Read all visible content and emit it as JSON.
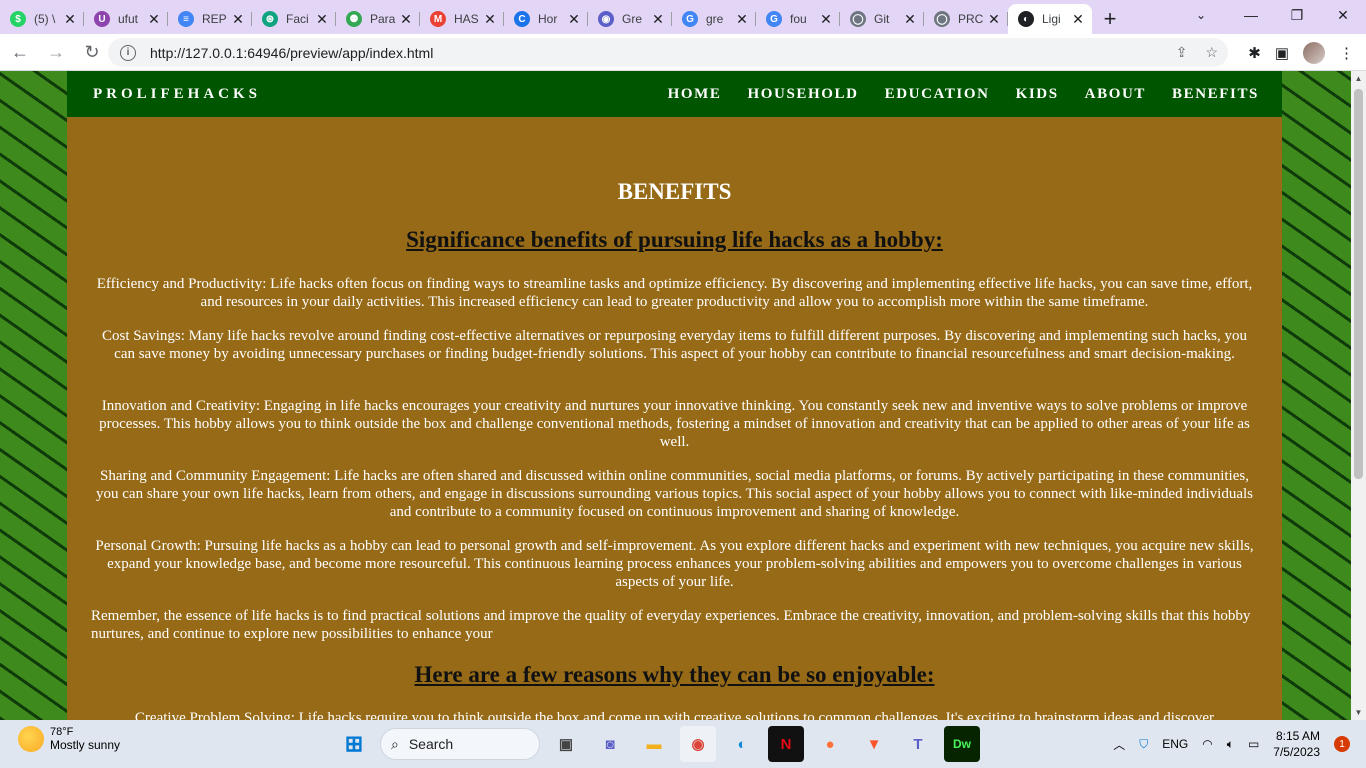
{
  "browser": {
    "tabs": [
      {
        "title": "(5) \\",
        "fav_color": "#25d366",
        "fav_glyph": "$"
      },
      {
        "title": "ufut",
        "fav_color": "#8e44ad",
        "fav_glyph": "U"
      },
      {
        "title": "REP",
        "fav_color": "#4285f4",
        "fav_glyph": "≡"
      },
      {
        "title": "Faci",
        "fav_color": "#10a37f",
        "fav_glyph": "⊛"
      },
      {
        "title": "Para",
        "fav_color": "#34a853",
        "fav_glyph": "⚉"
      },
      {
        "title": "HAS",
        "fav_color": "#ea4335",
        "fav_glyph": "M"
      },
      {
        "title": "Hor",
        "fav_color": "#1a73e8",
        "fav_glyph": "C"
      },
      {
        "title": "Gre",
        "fav_color": "#5b5fc7",
        "fav_glyph": "◉"
      },
      {
        "title": "gre",
        "fav_color": "#4285f4",
        "fav_glyph": "G"
      },
      {
        "title": "fou",
        "fav_color": "#4285f4",
        "fav_glyph": "G"
      },
      {
        "title": "Git",
        "fav_color": "#6e7681",
        "fav_glyph": "◯"
      },
      {
        "title": "PRC",
        "fav_color": "#6e7681",
        "fav_glyph": "◯"
      },
      {
        "title": "Ligi",
        "fav_color": "#202124",
        "fav_glyph": "◐",
        "active": true
      }
    ],
    "url": "http://127.0.0.1:64946/preview/app/index.html"
  },
  "site": {
    "brand": "PROLIFEHACKS",
    "menu": [
      "HOME",
      "HOUSEHOLD",
      "EDUCATION",
      "KIDS",
      "ABOUT",
      "BENEFITS"
    ],
    "page_title": "BENEFITS",
    "section1_heading": "Significance benefits of pursuing life hacks as a hobby:",
    "paragraphs": [
      "Efficiency and Productivity: Life hacks often focus on finding ways to streamline tasks and optimize efficiency. By discovering and implementing effective life hacks, you can save time, effort, and resources in your daily activities. This increased efficiency can lead to greater productivity and allow you to accomplish more within the same timeframe.",
      "Cost Savings: Many life hacks revolve around finding cost-effective alternatives or repurposing everyday items to fulfill different purposes. By discovering and implementing such hacks, you can save money by avoiding unnecessary purchases or finding budget-friendly solutions. This aspect of your hobby can contribute to financial resourcefulness and smart decision-making.",
      "Innovation and Creativity: Engaging in life hacks encourages your creativity and nurtures your innovative thinking. You constantly seek new and inventive ways to solve problems or improve processes. This hobby allows you to think outside the box and challenge conventional methods, fostering a mindset of innovation and creativity that can be applied to other areas of your life as well.",
      "Sharing and Community Engagement: Life hacks are often shared and discussed within online communities, social media platforms, or forums. By actively participating in these communities, you can share your own life hacks, learn from others, and engage in discussions surrounding various topics. This social aspect of your hobby allows you to connect with like-minded individuals and contribute to a community focused on continuous improvement and sharing of knowledge.",
      "Personal Growth: Pursuing life hacks as a hobby can lead to personal growth and self-improvement. As you explore different hacks and experiment with new techniques, you acquire new skills, expand your knowledge base, and become more resourceful. This continuous learning process enhances your problem-solving abilities and empowers you to overcome challenges in various aspects of your life."
    ],
    "closing": "Remember, the essence of life hacks is to find practical solutions and improve the quality of everyday experiences. Embrace the creativity, innovation, and problem-solving skills that this hobby nurtures, and continue to explore new possibilities to enhance your",
    "section2_heading": "Here are a few reasons why they can be so enjoyable:",
    "section2_first_line": "Creative Problem Solving: Life hacks require you to think outside the box and come up with creative solutions to common challenges. It's exciting to brainstorm ideas and discover"
  },
  "taskbar": {
    "temperature": "78°F",
    "weather": "Mostly sunny",
    "search_label": "Search",
    "language": "ENG",
    "time": "8:15 AM",
    "date": "7/5/2023",
    "notifications": "1"
  }
}
